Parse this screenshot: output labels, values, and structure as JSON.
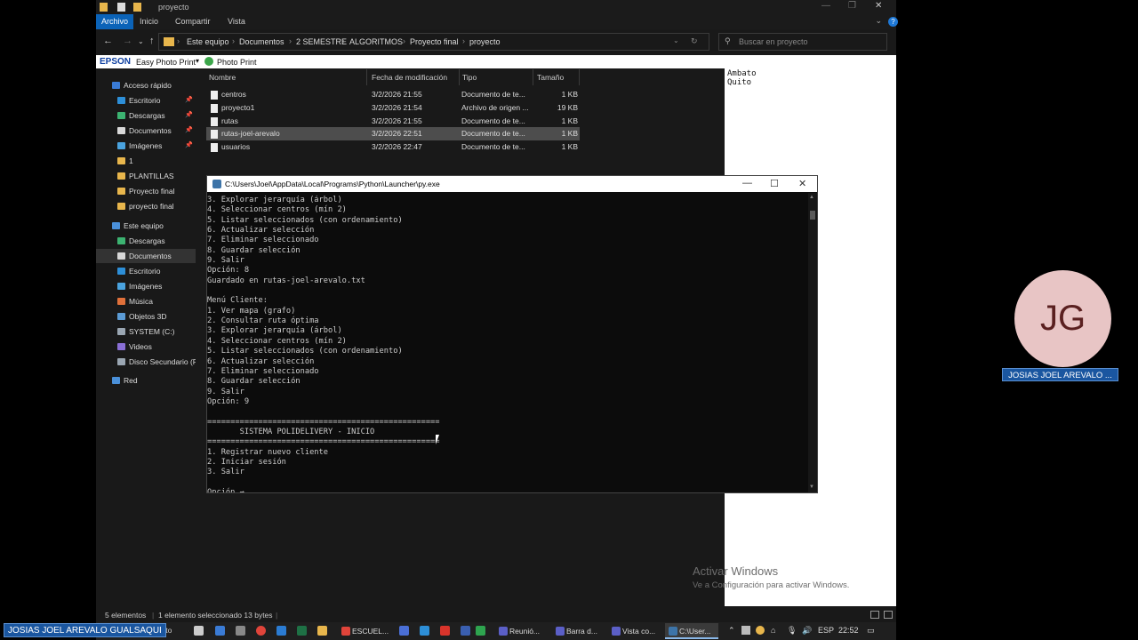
{
  "explorer": {
    "title": "proyecto",
    "ribbon_tabs": [
      "Archivo",
      "Inicio",
      "Compartir",
      "Vista"
    ],
    "breadcrumb": [
      "Este equipo",
      "Documentos",
      "2 SEMESTRE",
      "ALGORITMOS",
      "Proyecto final",
      "proyecto"
    ],
    "search_placeholder": "Buscar en proyecto",
    "epson": {
      "logo": "EPSON",
      "app": "Easy Photo Print",
      "photo_print": "Photo Print"
    },
    "nav": [
      {
        "label": "Acceso rápido",
        "color": "#3a7bd5"
      },
      {
        "label": "Escritorio",
        "color": "#2d8fd8",
        "pin": true
      },
      {
        "label": "Descargas",
        "color": "#3cb371",
        "pin": true
      },
      {
        "label": "Documentos",
        "color": "#d9d9d9",
        "pin": true
      },
      {
        "label": "Imágenes",
        "color": "#4aa3df",
        "pin": true
      },
      {
        "label": "1",
        "color": "#e8b64c"
      },
      {
        "label": "PLANTILLAS",
        "color": "#e8b64c"
      },
      {
        "label": "Proyecto final",
        "color": "#e8b64c"
      },
      {
        "label": "proyecto final",
        "color": "#e8b64c"
      },
      {
        "label": "Este equipo",
        "color": "#4a90d9"
      },
      {
        "label": "Descargas",
        "color": "#3cb371"
      },
      {
        "label": "Documentos",
        "color": "#d9d9d9"
      },
      {
        "label": "Escritorio",
        "color": "#2d8fd8"
      },
      {
        "label": "Imágenes",
        "color": "#4aa3df"
      },
      {
        "label": "Música",
        "color": "#e0703a"
      },
      {
        "label": "Objetos 3D",
        "color": "#5b9bd5"
      },
      {
        "label": "SYSTEM (C:)",
        "color": "#9aa6b2"
      },
      {
        "label": "Videos",
        "color": "#8a6fd6"
      },
      {
        "label": "Disco Secundario (F:",
        "color": "#9aa6b2"
      },
      {
        "label": "Red",
        "color": "#4a90d9"
      }
    ],
    "columns": [
      "Nombre",
      "Fecha de modificación",
      "Tipo",
      "Tamaño"
    ],
    "files": [
      {
        "name": "centros",
        "date": "3/2/2026 21:55",
        "type": "Documento de te...",
        "size": "1 KB"
      },
      {
        "name": "proyecto1",
        "date": "3/2/2026 21:54",
        "type": "Archivo de origen ...",
        "size": "19 KB"
      },
      {
        "name": "rutas",
        "date": "3/2/2026 21:55",
        "type": "Documento de te...",
        "size": "1 KB"
      },
      {
        "name": "rutas-joel-arevalo",
        "date": "3/2/2026 22:51",
        "type": "Documento de te...",
        "size": "1 KB"
      },
      {
        "name": "usuarios",
        "date": "3/2/2026 22:47",
        "type": "Documento de te...",
        "size": "1 KB"
      }
    ],
    "status": {
      "count": "5 elementos",
      "selection": "1 elemento seleccionado  13 bytes"
    }
  },
  "textpane": {
    "lines": [
      "Ambato",
      "Quito"
    ]
  },
  "console": {
    "title": "C:\\Users\\Joel\\AppData\\Local\\Programs\\Python\\Launcher\\py.exe",
    "lines": [
      "3. Explorar jerarquía (árbol)",
      "4. Seleccionar centros (mín 2)",
      "5. Listar seleccionados (con ordenamiento)",
      "6. Actualizar selección",
      "7. Eliminar seleccionado",
      "8. Guardar selección",
      "9. Salir",
      "Opción: 8",
      "Guardado en rutas-joel-arevalo.txt",
      "",
      "Menú Cliente:",
      "1. Ver mapa (grafo)",
      "2. Consultar ruta óptima",
      "3. Explorar jerarquía (árbol)",
      "4. Seleccionar centros (mín 2)",
      "5. Listar seleccionados (con ordenamiento)",
      "6. Actualizar selección",
      "7. Eliminar seleccionado",
      "8. Guardar selección",
      "9. Salir",
      "Opción: 9",
      "",
      "==================================================",
      "       SISTEMA POLIDELIVERY - INICIO",
      "==================================================",
      "1. Registrar nuevo cliente",
      "2. Iniciar sesión",
      "3. Salir",
      "",
      "Opción →"
    ]
  },
  "participant": {
    "initials": "JG",
    "name": "JOSIAS JOEL AREVALO ..."
  },
  "presenter": "JOSIAS JOEL AREVALO GUALSAQUI",
  "activation": {
    "title": "Activar Windows",
    "subtitle": "Ve a Configuración para activar Windows."
  },
  "taskbar": {
    "apps": [
      {
        "label": "ESCUEL...",
        "color": "#e0443a"
      },
      {
        "label": "Reunió...",
        "color": "#5b5fc7"
      },
      {
        "label": "Barra d...",
        "color": "#5b5fc7"
      },
      {
        "label": "Vista co...",
        "color": "#5b5fc7"
      },
      {
        "label": "C:\\User...",
        "color": "#3d74a8"
      }
    ],
    "lang": "ESP",
    "time": "22:52",
    "clipped_label": "cto"
  }
}
